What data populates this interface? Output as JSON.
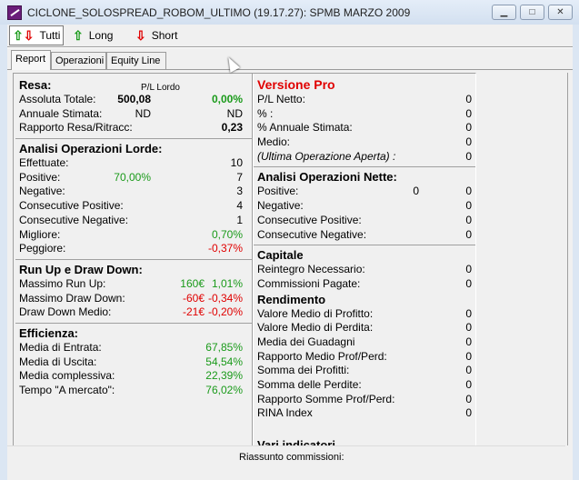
{
  "window": {
    "title": "CICLONE_SOLOSPREAD_ROBOM_ULTIMO (19.17.27): SPMB MARZO 2009",
    "buttons": [
      "minimize",
      "maximize",
      "close"
    ]
  },
  "toolbar": [
    {
      "label": "Tutti",
      "icon": "up-down-arrows-icon",
      "selected": true
    },
    {
      "label": "Long",
      "icon": "up-arrow-icon"
    },
    {
      "label": "Short",
      "icon": "down-arrow-icon"
    }
  ],
  "tabs": [
    {
      "label": "Report",
      "active": true
    },
    {
      "label": "Operazioni"
    },
    {
      "label": "Equity Line"
    }
  ],
  "colors": {
    "positive": "#1a9a1a",
    "negative": "#e00000",
    "pro": "#e00000"
  },
  "left": [
    {
      "h": "Resa:",
      "sub": "P/L Lordo"
    },
    {
      "l": "Assoluta Totale:",
      "m": "500,08",
      "mb": true,
      "r": "0,00%",
      "rc": "green",
      "rb": true
    },
    {
      "l": "Annuale Stimata:",
      "m": "ND",
      "r": "ND"
    },
    {
      "l": "Rapporto Resa/Ritracc:",
      "r": "0,23",
      "rb": true
    },
    {
      "sep": true
    },
    {
      "h": "Analisi Operazioni Lorde:"
    },
    {
      "l": "Effettuate:",
      "r": "10"
    },
    {
      "l": "Positive:",
      "m": "70,00%",
      "mc": "green",
      "r": "7"
    },
    {
      "l": "Negative:",
      "r": "3"
    },
    {
      "l": "Consecutive Positive:",
      "r": "4"
    },
    {
      "l": "Consecutive Negative:",
      "r": "1"
    },
    {
      "l": "Migliore:",
      "r": "0,70%",
      "rc": "green"
    },
    {
      "l": "Peggiore:",
      "r": "-0,37%",
      "rc": "red"
    },
    {
      "sep": true
    },
    {
      "h": "Run Up e Draw Down:"
    },
    {
      "l": "Massimo Run Up:",
      "m2": "160€",
      "r": "1,01%",
      "rc": "green"
    },
    {
      "l": "Massimo Draw Down:",
      "m2": "-60€",
      "r": "-0,34%",
      "rc": "red"
    },
    {
      "l": "Draw Down Medio:",
      "m2": "-21€",
      "r": "-0,20%",
      "rc": "red"
    },
    {
      "sep": true
    },
    {
      "h": "Efficienza:"
    },
    {
      "l": "Media di Entrata:",
      "r": "67,85%",
      "rc": "green"
    },
    {
      "l": "Media di Uscita:",
      "r": "54,54%",
      "rc": "green"
    },
    {
      "l": "Media complessiva:",
      "r": "22,39%",
      "rc": "green"
    },
    {
      "l": "Tempo \"A mercato\":",
      "r": "76,02%",
      "rc": "green"
    }
  ],
  "right": [
    {
      "h": "Versione Pro",
      "hc": "red"
    },
    {
      "l": "P/L Netto:",
      "r": "0"
    },
    {
      "l": "% :",
      "r": "0"
    },
    {
      "l": "% Annuale Stimata:",
      "r": "0"
    },
    {
      "l": "Medio:",
      "r": "0"
    },
    {
      "l": "(Ultima Operazione Aperta) :",
      "li": true,
      "r": "0"
    },
    {
      "sep": true
    },
    {
      "h": "Analisi Operazioni Nette:"
    },
    {
      "l": "Positive:",
      "m": "0",
      "r": "0"
    },
    {
      "l": "Negative:",
      "r": "0"
    },
    {
      "l": "Consecutive Positive:",
      "r": "0"
    },
    {
      "l": "Consecutive Negative:",
      "r": "0"
    },
    {
      "sep": true
    },
    {
      "h": "Capitale"
    },
    {
      "l": "Reintegro Necessario:",
      "r": "0"
    },
    {
      "l": "Commissioni Pagate:",
      "r": "0"
    },
    {
      "h": "Rendimento"
    },
    {
      "l": "Valore Medio di Profitto:",
      "r": "0"
    },
    {
      "l": "Valore Medio di Perdita:",
      "r": "0"
    },
    {
      "l": "Media dei Guadagni",
      "r": "0"
    },
    {
      "l": "Rapporto Medio Prof/Perd:",
      "r": "0"
    },
    {
      "l": "Somma dei Profitti:",
      "r": "0"
    },
    {
      "l": "Somma delle Perdite:",
      "r": "0"
    },
    {
      "l": "Rapporto Somme Prof/Perd:",
      "r": "0"
    },
    {
      "l": "RINA Index",
      "r": "0"
    },
    {
      "gap": true
    },
    {
      "h": "Vari indicatori"
    }
  ],
  "footer": {
    "label": "Riassunto commissioni:"
  }
}
